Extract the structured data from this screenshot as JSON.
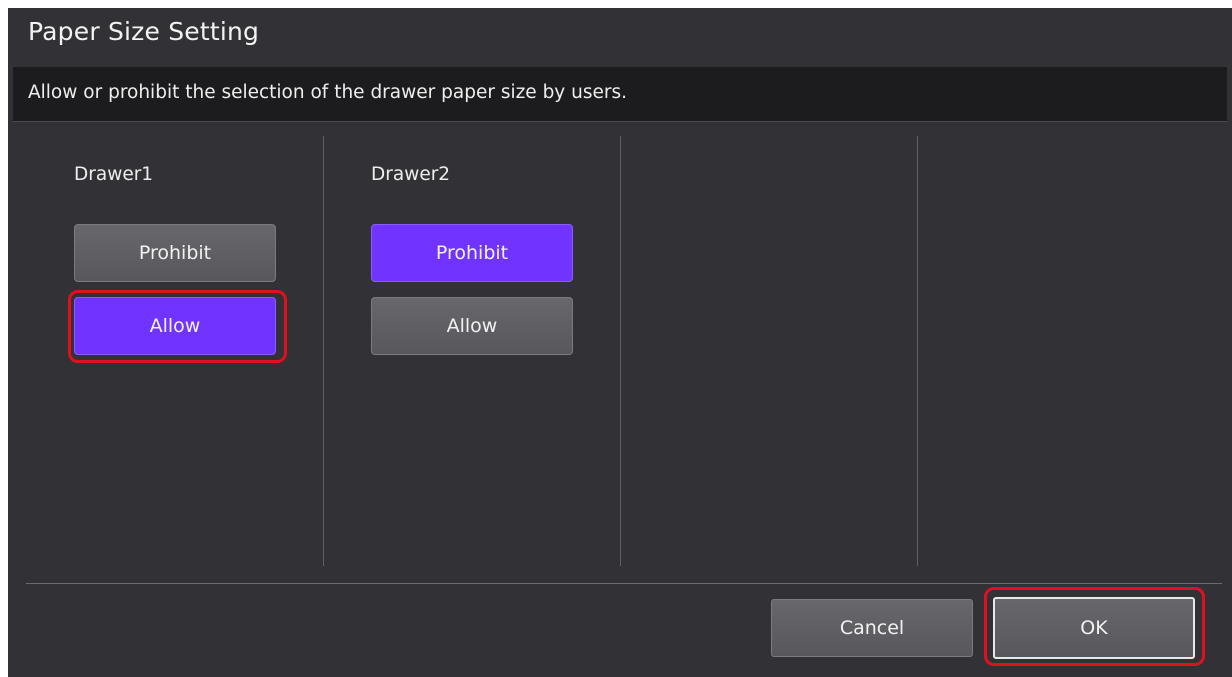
{
  "dialog": {
    "title": "Paper Size Setting",
    "description": "Allow or prohibit the selection of the drawer paper size by users."
  },
  "drawers": [
    {
      "label": "Drawer1",
      "prohibit_label": "Prohibit",
      "allow_label": "Allow",
      "selected": "Allow"
    },
    {
      "label": "Drawer2",
      "prohibit_label": "Prohibit",
      "allow_label": "Allow",
      "selected": "Prohibit"
    }
  ],
  "footer": {
    "cancel_label": "Cancel",
    "ok_label": "OK"
  },
  "colors": {
    "background": "#323236",
    "description_bar": "#1c1c1e",
    "selected_button": "#7133ff",
    "unselected_button": "#5f5f64",
    "highlight": "#e0101e"
  }
}
